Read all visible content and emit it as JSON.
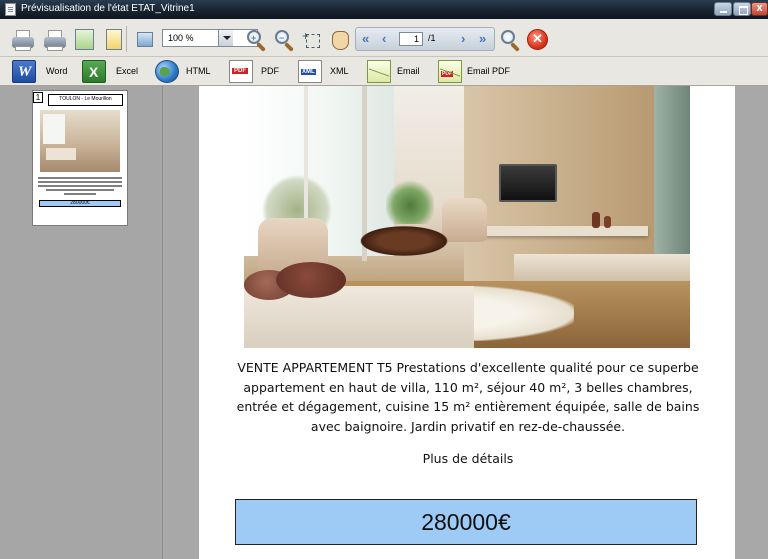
{
  "window": {
    "title": "Prévisualisation de l'état ETAT_Vitrine1"
  },
  "toolbar": {
    "zoom_value": "100 %",
    "page_current": "1",
    "page_total": "/1",
    "nav_first": "«",
    "nav_prev": "‹",
    "nav_next": "›",
    "nav_last": "»",
    "close_label": "✕"
  },
  "export_toolbar": {
    "buttons": [
      {
        "label": "Word",
        "icon": "word-icon"
      },
      {
        "label": "Excel",
        "icon": "excel-icon"
      },
      {
        "label": "HTML",
        "icon": "globe-icon"
      },
      {
        "label": "PDF",
        "icon": "pdf-icon"
      },
      {
        "label": "XML",
        "icon": "xml-icon"
      },
      {
        "label": "Email",
        "icon": "email-icon"
      },
      {
        "label": "Email PDF",
        "icon": "email-pdf-icon"
      }
    ],
    "word_glyph": "W",
    "excel_glyph": "X",
    "pdf_glyph": "PDF",
    "xml_glyph": "XML"
  },
  "thumbnail": {
    "page_number": "1",
    "title": "TOULON - Le Mourillon",
    "price": "280000€"
  },
  "listing": {
    "description": "VENTE APPARTEMENT T5 Prestations d'excellente qualité pour ce superbe appartement en haut de villa, 110 m², séjour 40 m², 3 belles chambres, entrée et dégagement, cuisine 15 m² entièrement équipée, salle de bains avec baignoire. Jardin privatif en rez-de-chaussée.",
    "more_link": "Plus de détails",
    "price": "280000€"
  },
  "colors": {
    "price_box": "#9ecbf6",
    "titlebar": "#16222e"
  }
}
